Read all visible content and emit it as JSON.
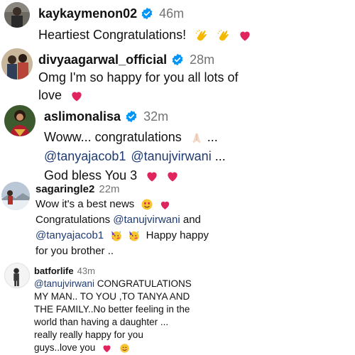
{
  "comments": [
    {
      "username": "kaykaymenon02",
      "verified": true,
      "time": "46m",
      "lines": [
        {
          "text": "Heartiest Congratulations!",
          "emojis": [
            "clapping-hands",
            "clapping-hands",
            "red-heart"
          ]
        }
      ]
    },
    {
      "username": "divyaagarwal_official",
      "verified": true,
      "time": "28m",
      "lines": [
        {
          "text": "Omg I'm so happy for you all lots of"
        },
        {
          "text": "love",
          "emojis": [
            "red-heart"
          ]
        }
      ]
    },
    {
      "username": "aslimonalisa",
      "verified": true,
      "time": "32m",
      "lines": [
        {
          "text": "Woww... congratulations",
          "emoji_then": "folded-hands",
          "trail": "..."
        },
        {
          "mention1": "@tanyajacob1",
          "mention2": "@tanujvirwani",
          "trail": "..."
        },
        {
          "text": "God bless You 3",
          "emojis": [
            "red-heart",
            "red-heart"
          ]
        }
      ]
    },
    {
      "username": "sagaringle2",
      "verified": false,
      "time": "22m",
      "lines": [
        {
          "text": "Wow it's a best news",
          "emojis": [
            "heart-eyes",
            "red-heart"
          ]
        },
        {
          "text": "Congratulations",
          "mention": "@tanujvirwani",
          "trail": "and"
        },
        {
          "mention": "@tanyajacob1",
          "emojis": [
            "partying-face",
            "partying-face"
          ],
          "text": "Happy happy"
        },
        {
          "text": "for you brother .."
        }
      ]
    },
    {
      "username": "batforlife",
      "verified": false,
      "time": "43m",
      "lines": [
        {
          "mention": "@tanujvirwani",
          "text": "CONGRATULATIONS"
        },
        {
          "text": "MY MAN.. TO YOU ,TO TANYA AND"
        },
        {
          "text": "THE FAMILY..No better feeling in the"
        },
        {
          "text": "world than having a daughter ..."
        },
        {
          "text": "really really happy for you"
        },
        {
          "text": "guys..love you",
          "emojis": [
            "red-heart",
            "smiling-face"
          ]
        }
      ]
    }
  ],
  "colors": {
    "username": "#111111",
    "time": "#737373",
    "mention": "#1f3b73",
    "verified": "#0095f6",
    "heart": "#e0245e"
  }
}
